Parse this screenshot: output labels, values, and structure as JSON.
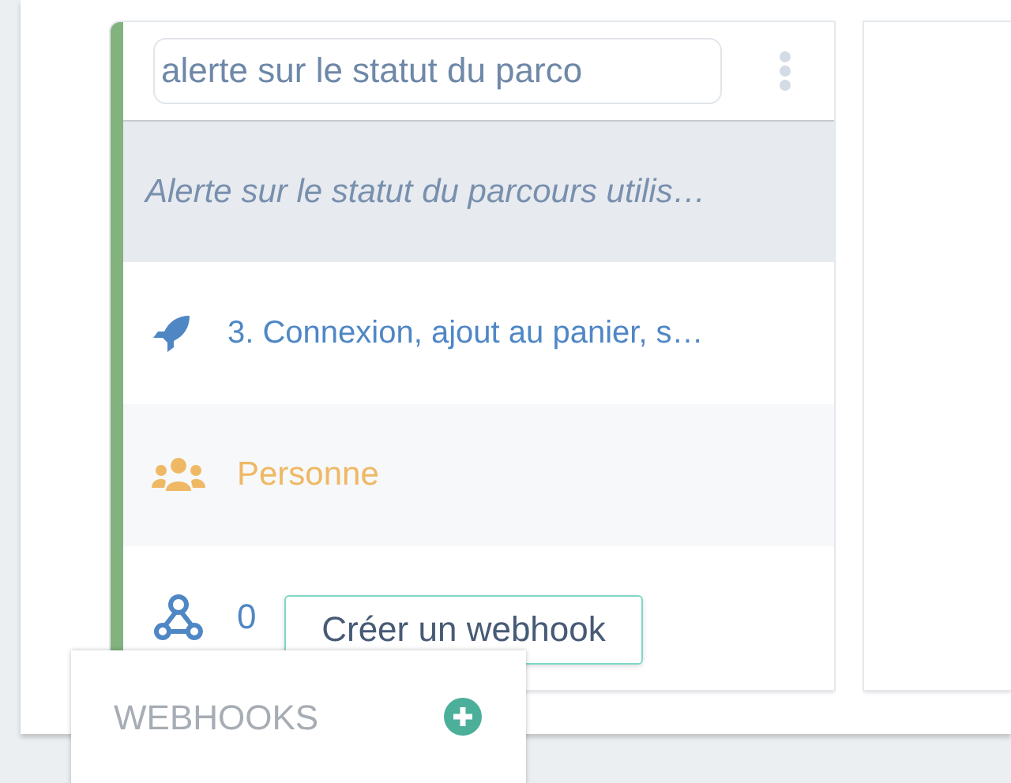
{
  "card": {
    "title_field": {
      "value": "alerte sur le statut du parco"
    },
    "description": "Alerte sur le statut du parcours utilis…",
    "rows": [
      {
        "kind": "journey",
        "text": "3. Connexion, ajout au panier, s…"
      },
      {
        "kind": "audience",
        "text": "Personne"
      },
      {
        "kind": "webhooks",
        "text": "0"
      }
    ]
  },
  "tooltip": "Créer un webhook",
  "webhooks_menu": {
    "title": "WEBHOOKS"
  }
}
